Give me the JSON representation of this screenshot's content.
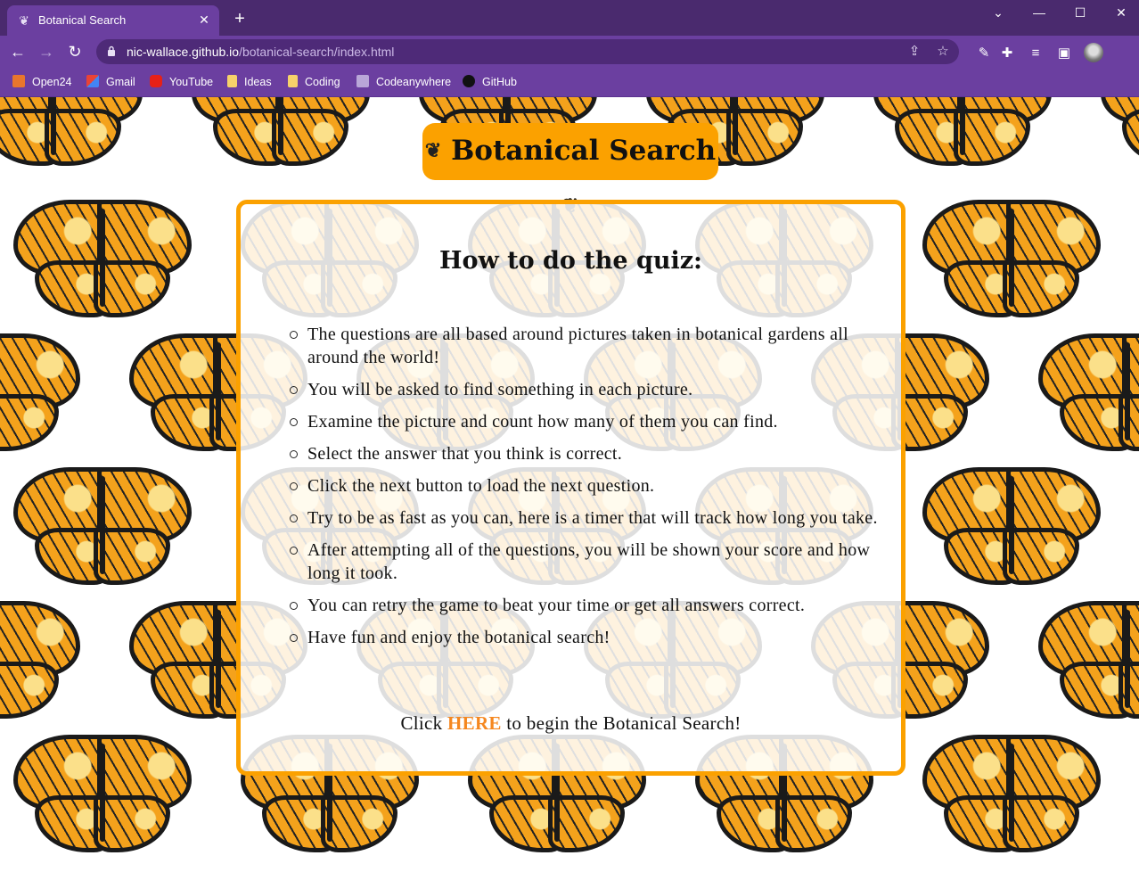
{
  "browser": {
    "tab_title": "Botanical Search",
    "url_host": "nic-wallace.github.io",
    "url_path": "/botanical-search/index.html",
    "bookmarks": [
      "Open24",
      "Gmail",
      "YouTube",
      "Ideas",
      "Coding",
      "Codeanywhere",
      "GitHub"
    ]
  },
  "page": {
    "site_title": "Botanical Search",
    "card_heading": "How to do the quiz:",
    "rules": [
      "The questions are all based around pictures taken in botanical gardens all around the world!",
      "You will be asked to find something in each picture.",
      "Examine the picture and count how many of them you can find.",
      "Select the answer that you think is correct.",
      "Click the next button to load the next question.",
      "Try to be as fast as you can, here is a timer that will track how long you take.",
      "After attempting all of the questions, you will be shown your score and how long it took.",
      "You can retry the game to beat your time or get all answers correct.",
      "Have fun and enjoy the botanical search!"
    ],
    "cta_prefix": "Click",
    "cta_link": "HERE",
    "cta_suffix": "to begin the Botanical Search!"
  },
  "colors": {
    "accent_orange": "#fba100",
    "link_orange": "#f5871f",
    "chrome_purple": "#6b3fa0"
  }
}
